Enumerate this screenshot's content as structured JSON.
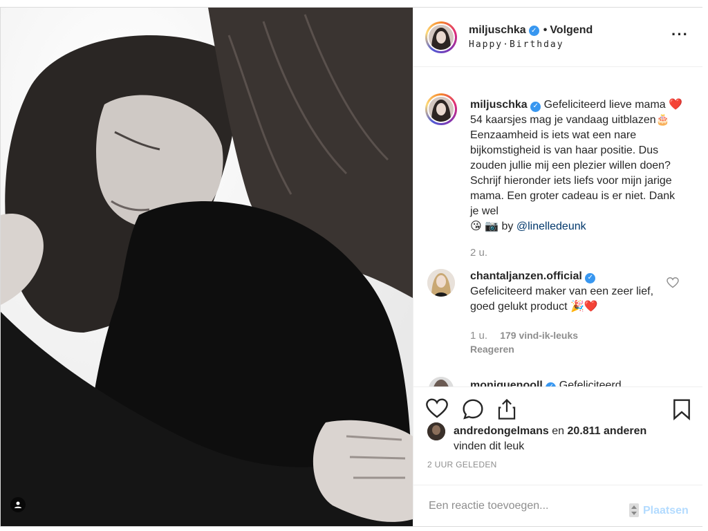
{
  "post": {
    "username": "miljuschka",
    "verified": true,
    "follow_status": "Volgend",
    "subtitle": "Happy·Birthday"
  },
  "caption": {
    "username": "miljuschka",
    "text_1": "Gefeliciteerd lieve mama",
    "heart": "❤️",
    "text_2": "54 kaarsjes mag je vandaag uitblazen",
    "cake": "🎂",
    "text_3": "Eenzaamheid is iets wat een nare bijkomstigheid is van haar positie. Dus zouden jullie mij een plezier willen doen? Schrijf hieronder iets liefs voor mijn jarige mama. Een groter cadeau is er niet. Dank je wel",
    "kiss": "😘",
    "camera": "📷",
    "by": "by",
    "mention": "@linelledeunk",
    "time": "2 u."
  },
  "comments": [
    {
      "username": "chantaljanzen.official",
      "verified": true,
      "text": "Gefeliciteerd maker van een zeer lief, goed gelukt product",
      "emojis": "🎉❤️",
      "time": "1 u.",
      "likes": "179 vind-ik-leuks",
      "reply": "Reageren"
    },
    {
      "username": "moniquenooll",
      "verified": true,
      "text": "Gefeliciteerd"
    }
  ],
  "likes": {
    "user": "andredongelmans",
    "connector": "en",
    "count": "20.811 anderen",
    "suffix": "vinden dit leuk"
  },
  "date": "2 UUR GELEDEN",
  "input": {
    "placeholder": "Een reactie toevoegen...",
    "post_label": "Plaatsen"
  },
  "icons": {
    "like": "heart-icon",
    "comment": "comment-icon",
    "share": "share-icon",
    "save": "bookmark-icon",
    "more": "more-options-icon",
    "tag": "user-tag-icon"
  },
  "colors": {
    "verified": "#3897f0",
    "link": "#00376b",
    "muted": "#8e8e8e",
    "post_button": "#b3dbff"
  }
}
